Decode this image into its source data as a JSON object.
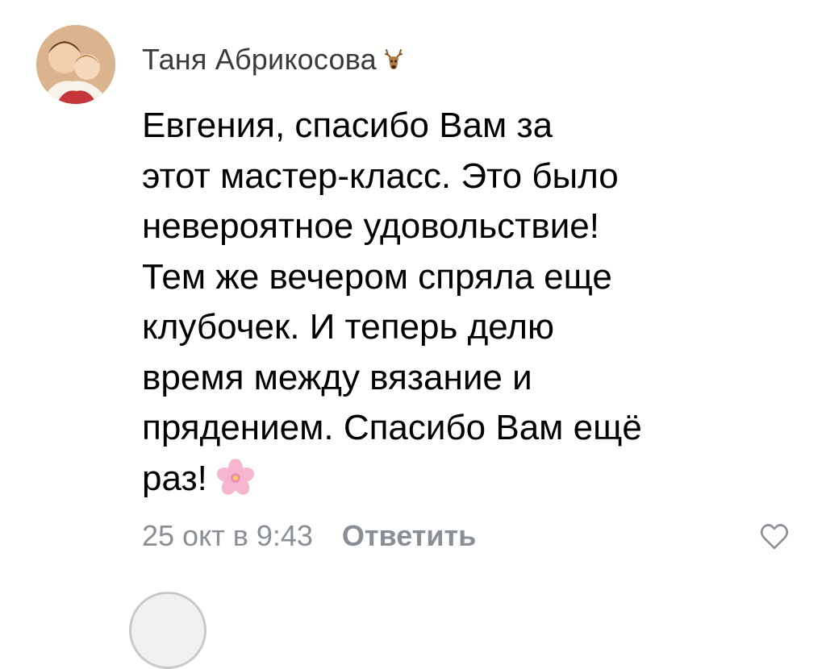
{
  "comment": {
    "author": "Таня Абрикосова",
    "author_badge_icon": "deer-icon",
    "text_lines": [
      "Евгения, спасибо Вам за",
      "этот мастер-класс. Это было",
      "невероятное удовольствие!",
      "Тем же вечером спряла еще",
      "клубочек. И теперь делю",
      "время между вязание и",
      "прядением. Спасибо Вам ещё",
      "раз!"
    ],
    "trailing_emoji_icon": "cherry-blossom-icon",
    "timestamp": "25 окт в 9:43",
    "reply_label": "Ответить",
    "like_icon": "heart-outline-icon"
  },
  "colors": {
    "author": "#3a3a3a",
    "meta": "#8a8f96",
    "text": "#000000"
  }
}
